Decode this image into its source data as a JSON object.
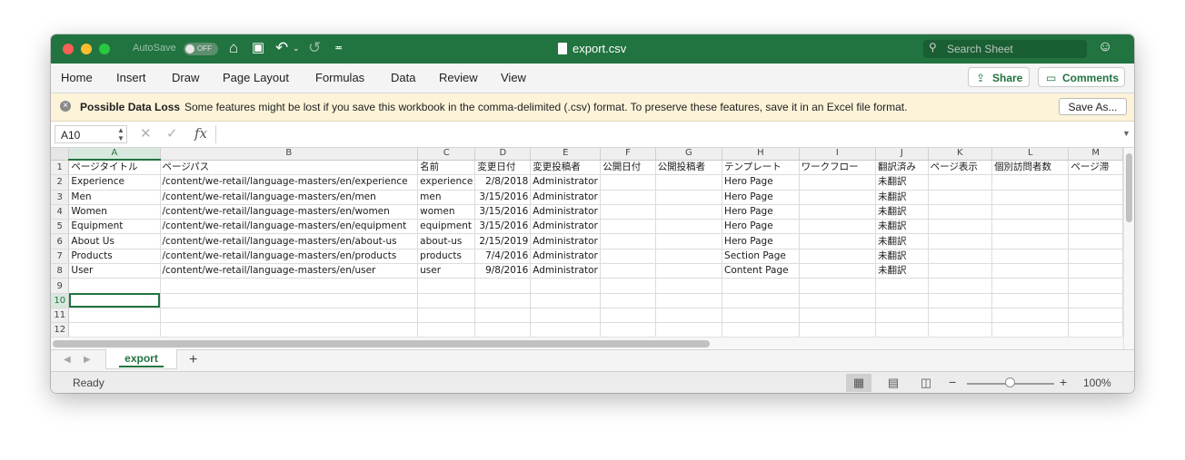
{
  "titlebar": {
    "autosave_label": "AutoSave",
    "autosave_state": "OFF",
    "file_name": "export.csv",
    "search_placeholder": "Search Sheet"
  },
  "ribbon": {
    "tabs": [
      "Home",
      "Insert",
      "Draw",
      "Page Layout",
      "Formulas",
      "Data",
      "Review",
      "View"
    ],
    "share_label": "Share",
    "comments_label": "Comments"
  },
  "message_bar": {
    "title": "Possible Data Loss",
    "text": "Some features might be lost if you save this workbook in the comma-delimited (.csv) format. To preserve these features, save it in an Excel file format.",
    "button": "Save As..."
  },
  "formula_bar": {
    "name_box": "A10",
    "fx": "fx",
    "formula": ""
  },
  "grid": {
    "columns": [
      "A",
      "B",
      "C",
      "D",
      "E",
      "F",
      "G",
      "H",
      "I",
      "J",
      "K",
      "L",
      "M"
    ],
    "row_numbers": [
      "1",
      "2",
      "3",
      "4",
      "5",
      "6",
      "7",
      "8",
      "9",
      "10",
      "11",
      "12"
    ],
    "selected_cell": "A10",
    "rows": [
      [
        "ページタイトル",
        "ページパス",
        "名前",
        "変更日付",
        "変更投稿者",
        "公開日付",
        "公開投稿者",
        "テンプレート",
        "ワークフロー",
        "翻訳済み",
        "ページ表示",
        "個別訪問者数",
        "ページ滞"
      ],
      [
        "Experience",
        "/content/we-retail/language-masters/en/experience",
        "experience",
        "2/8/2018",
        "Administrator",
        "",
        "",
        "Hero Page",
        "",
        "未翻訳",
        "",
        "",
        ""
      ],
      [
        "Men",
        "/content/we-retail/language-masters/en/men",
        "men",
        "3/15/2016",
        "Administrator",
        "",
        "",
        "Hero Page",
        "",
        "未翻訳",
        "",
        "",
        ""
      ],
      [
        "Women",
        "/content/we-retail/language-masters/en/women",
        "women",
        "3/15/2016",
        "Administrator",
        "",
        "",
        "Hero Page",
        "",
        "未翻訳",
        "",
        "",
        ""
      ],
      [
        "Equipment",
        "/content/we-retail/language-masters/en/equipment",
        "equipment",
        "3/15/2016",
        "Administrator",
        "",
        "",
        "Hero Page",
        "",
        "未翻訳",
        "",
        "",
        ""
      ],
      [
        "About Us",
        "/content/we-retail/language-masters/en/about-us",
        "about-us",
        "2/15/2019",
        "Administrator",
        "",
        "",
        "Hero Page",
        "",
        "未翻訳",
        "",
        "",
        ""
      ],
      [
        "Products",
        "/content/we-retail/language-masters/en/products",
        "products",
        "7/4/2016",
        "Administrator",
        "",
        "",
        "Section Page",
        "",
        "未翻訳",
        "",
        "",
        ""
      ],
      [
        "User",
        "/content/we-retail/language-masters/en/user",
        "user",
        "9/8/2016",
        "Administrator",
        "",
        "",
        "Content Page",
        "",
        "未翻訳",
        "",
        "",
        ""
      ],
      [
        "",
        "",
        "",
        "",
        "",
        "",
        "",
        "",
        "",
        "",
        "",
        "",
        ""
      ],
      [
        "",
        "",
        "",
        "",
        "",
        "",
        "",
        "",
        "",
        "",
        "",
        "",
        ""
      ],
      [
        "",
        "",
        "",
        "",
        "",
        "",
        "",
        "",
        "",
        "",
        "",
        "",
        ""
      ],
      [
        "",
        "",
        "",
        "",
        "",
        "",
        "",
        "",
        "",
        "",
        "",
        "",
        ""
      ]
    ]
  },
  "sheets": {
    "tabs": [
      "export"
    ],
    "add_label": "+"
  },
  "status": {
    "text": "Ready",
    "zoom": "100%",
    "zoom_fraction": 0.5
  },
  "colors": {
    "accent": "#21733f",
    "message_bar": "#fcf3d9"
  },
  "icons": [
    "close-dot",
    "minimize-dot",
    "maximize-dot",
    "home-icon",
    "save-icon",
    "undo-icon",
    "redo-icon",
    "customize-icon",
    "file-icon",
    "search-icon",
    "smiley-icon",
    "share-icon",
    "comments-icon",
    "warning-icon",
    "cancel-icon",
    "confirm-icon",
    "fx-icon",
    "normal-view-icon",
    "page-layout-icon",
    "page-break-icon"
  ]
}
